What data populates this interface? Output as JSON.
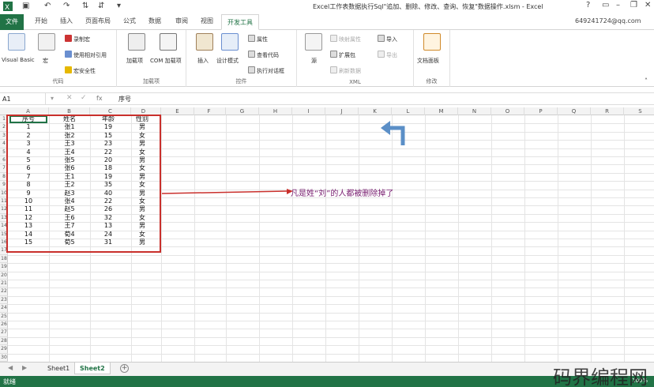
{
  "window": {
    "title": "Excel工作表数据执行Sql\"追加、删除、修改、查询、恢复\"数据操作.xlsm - Excel",
    "account": "649241724@qq.com",
    "help": "?"
  },
  "tabs": [
    "文件",
    "开始",
    "插入",
    "页面布局",
    "公式",
    "数据",
    "审阅",
    "视图",
    "开发工具"
  ],
  "ribbon": {
    "code": {
      "vb": "Visual Basic",
      "macro": "宏",
      "record": "录制宏",
      "relative": "使用相对引用",
      "security": "宏安全性",
      "label": "代码"
    },
    "addins": {
      "addin": "加载项",
      "com": "COM 加载项",
      "label": "加载项"
    },
    "controls": {
      "insert": "插入",
      "design": "设计模式",
      "props": "属性",
      "viewcode": "查看代码",
      "dialog": "执行对话框",
      "label": "控件"
    },
    "xml": {
      "source": "源",
      "map": "映射属性",
      "ext": "扩展包",
      "refresh": "刷新数据",
      "import": "导入",
      "export": "导出",
      "label": "XML"
    },
    "modify": {
      "panel": "文档面板",
      "label": "修改"
    }
  },
  "formula_bar": {
    "name_box": "A1",
    "fx": "fx",
    "value": "序号"
  },
  "columns": [
    "A",
    "B",
    "C",
    "D",
    "E",
    "F",
    "G",
    "H",
    "I",
    "J",
    "K",
    "L",
    "M",
    "N",
    "O",
    "P",
    "Q",
    "R",
    "S"
  ],
  "row_numbers": [
    "1",
    "2",
    "3",
    "4",
    "5",
    "6",
    "7",
    "8",
    "9",
    "10",
    "11",
    "12",
    "13",
    "14",
    "15",
    "16",
    "17",
    "18",
    "19",
    "20",
    "21",
    "22",
    "23",
    "24",
    "25",
    "26",
    "27",
    "28",
    "29",
    "30"
  ],
  "table": {
    "headers": [
      "序号",
      "姓名",
      "年龄",
      "性别"
    ],
    "rows": [
      [
        "1",
        "张1",
        "19",
        "男"
      ],
      [
        "2",
        "张2",
        "15",
        "女"
      ],
      [
        "3",
        "王3",
        "23",
        "男"
      ],
      [
        "4",
        "王4",
        "22",
        "女"
      ],
      [
        "5",
        "张5",
        "20",
        "男"
      ],
      [
        "6",
        "张6",
        "18",
        "女"
      ],
      [
        "7",
        "王1",
        "19",
        "男"
      ],
      [
        "8",
        "王2",
        "35",
        "女"
      ],
      [
        "9",
        "赵3",
        "40",
        "男"
      ],
      [
        "10",
        "张4",
        "22",
        "女"
      ],
      [
        "11",
        "赵5",
        "26",
        "男"
      ],
      [
        "12",
        "王6",
        "32",
        "女"
      ],
      [
        "13",
        "王7",
        "13",
        "男"
      ],
      [
        "14",
        "荀4",
        "24",
        "女"
      ],
      [
        "15",
        "荀5",
        "31",
        "男"
      ]
    ]
  },
  "annotation": "凡是姓“刘”的人都被删除掉了",
  "sheets": [
    "Sheet1",
    "Sheet2"
  ],
  "active_sheet": "Sheet2",
  "status": {
    "ready": "就绪",
    "zoom": "100%"
  },
  "watermark": "码界编程网",
  "colors": {
    "excel_green": "#217346",
    "red_box": "#c9302c",
    "annotation": "#7a2072",
    "blue_arrow": "#5b8fc7"
  }
}
